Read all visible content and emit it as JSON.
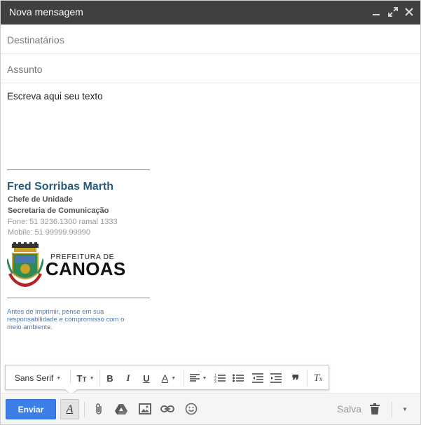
{
  "window": {
    "title": "Nova mensagem"
  },
  "compose": {
    "to_placeholder": "Destinatários",
    "subject_placeholder": "Assunto",
    "body_placeholder": "Escreva aqui seu texto"
  },
  "signature": {
    "name": "Fred Sorribas Marth",
    "role": "Chefe de Unidade",
    "department": "Secretaria de Comunicação",
    "phone": "Fone: 51 3236.1300 ramal 1333",
    "mobile": "Mobile: 51 99999.99990",
    "logo_top": "PREFEITURA DE",
    "logo_main": "CANOAS",
    "eco_note": "Antes de imprimir, pense em sua responsabilidade e compromisso com o meio ambiente.",
    "name_color": "#2a5b7a"
  },
  "format_toolbar": {
    "font_family": "Sans Serif",
    "icons": [
      "font-size-icon",
      "bold-icon",
      "italic-icon",
      "underline-icon",
      "text-color-icon",
      "align-icon",
      "numbered-list-icon",
      "bulleted-list-icon",
      "indent-less-icon",
      "indent-more-icon",
      "quote-icon",
      "remove-formatting-icon"
    ]
  },
  "bottom_bar": {
    "send_label": "Enviar",
    "saved_label": "Salva",
    "send_color": "#3d7ee8"
  }
}
